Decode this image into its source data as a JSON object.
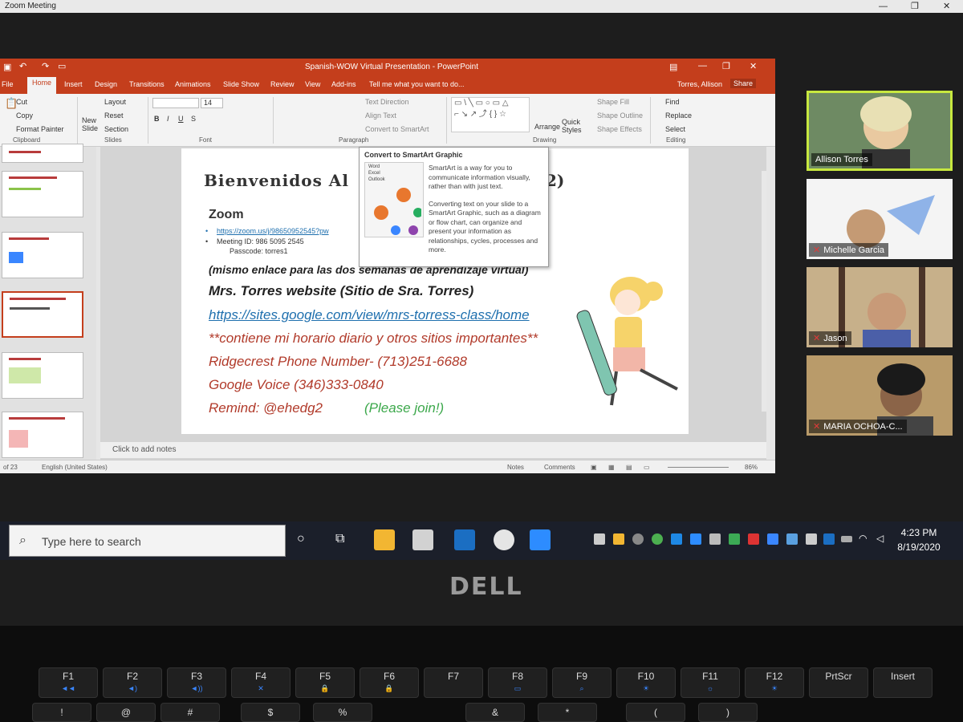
{
  "zoom": {
    "window_title": "Zoom Meeting"
  },
  "ppt": {
    "title": "Spanish-WOW Virtual Presentation - PowerPoint",
    "user": "Torres, Allison",
    "share": "Share",
    "tabs": [
      "File",
      "Home",
      "Insert",
      "Design",
      "Transitions",
      "Animations",
      "Slide Show",
      "Review",
      "View",
      "Add-ins"
    ],
    "tell_me": "Tell me what you want to do...",
    "ribbon": {
      "clipboard": {
        "cut": "Cut",
        "copy": "Copy",
        "format_painter": "Format Painter",
        "label": "Clipboard"
      },
      "slides": {
        "new_slide": "New Slide",
        "layout": "Layout",
        "reset": "Reset",
        "section": "Section",
        "label": "Slides"
      },
      "font": {
        "size": "14",
        "label": "Font"
      },
      "paragraph": {
        "text_direction": "Text Direction",
        "align_text": "Align Text",
        "smartart": "Convert to SmartArt",
        "label": "Paragraph"
      },
      "drawing": {
        "arrange": "Arrange",
        "quick_styles": "Quick Styles",
        "shape_fill": "Shape Fill",
        "shape_outline": "Shape Outline",
        "shape_effects": "Shape Effects",
        "label": "Drawing"
      },
      "editing": {
        "find": "Find",
        "replace": "Replace",
        "select": "Select",
        "label": "Editing"
      }
    },
    "slide": {
      "title_left": "Bienvenidos Al",
      "title_right": "2)",
      "zoom_heading": "Zoom",
      "bullets": [
        "https://zoom.us/j/98650952545?pw",
        "Meeting ID: 986 5095 2545",
        "Passcode: torres1"
      ],
      "mismo": "(mismo enlace para las dos semanas de aprendizaje virtual)",
      "mrs": "Mrs. Torres website (Sitio de Sra. Torres)",
      "link": "https://sites.google.com/view/mrs-torress-class/home",
      "contiene": "**contiene mi horario diario y otros sitios importantes**",
      "ridgecrest": "Ridgecrest Phone Number- (713)251-6688",
      "google_voice": "Google Voice (346)333-0840",
      "remind": "Remind: @ehedg2",
      "join": "(Please join!)"
    },
    "tooltip": {
      "title": "Convert to SmartArt Graphic",
      "body1": "SmartArt is a way for you to communicate information visually, rather than with just text.",
      "body2": "Converting text on your slide to a SmartArt Graphic, such as a diagram or flow chart, can organize and present your information as relationships, cycles, processes and more.",
      "img_items": [
        "Word",
        "Excel",
        "Outlook"
      ]
    },
    "notes_placeholder": "Click to add notes",
    "status": {
      "slide_count": "of 23",
      "language": "English (United States)",
      "notes": "Notes",
      "comments": "Comments",
      "zoom": "86%"
    }
  },
  "participants": [
    {
      "name": "Allison Torres",
      "muted": false,
      "active": true
    },
    {
      "name": "Michelle Garcia",
      "muted": true,
      "active": false
    },
    {
      "name": "Jason",
      "muted": true,
      "active": false
    },
    {
      "name": "MARIA OCHOA-C...",
      "muted": true,
      "active": false
    }
  ],
  "taskbar": {
    "search_placeholder": "Type here to search",
    "time": "4:23 PM",
    "date": "8/19/2020"
  },
  "laptop": {
    "brand": "DELL"
  },
  "keys": {
    "fn_row": [
      "F1",
      "F2",
      "F3",
      "F4",
      "F5",
      "F6",
      "F7",
      "F8",
      "F9",
      "F10",
      "F11",
      "F12",
      "PrtScr",
      "Insert"
    ],
    "num_row": [
      "!",
      "@",
      "#",
      "$",
      "%",
      "&",
      "*",
      "(",
      ")"
    ]
  }
}
